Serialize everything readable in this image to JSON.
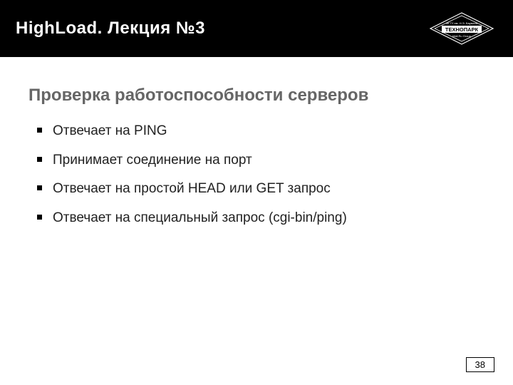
{
  "header": {
    "title": "HighLoad. Лекция №3",
    "logo_text_top": "МГТУ им. Н.Э. Баумана",
    "logo_text_main": "ТЕХНОПАРК",
    "logo_text_sub": "Mail.Ru Group"
  },
  "content": {
    "heading": "Проверка работоспособности серверов",
    "bullets": [
      "Отвечает на PING",
      "Принимает соединение на порт",
      "Отвечает на простой HEAD или GET запрос",
      "Отвечает на специальный запрос (cgi-bin/ping)"
    ]
  },
  "page_number": "38"
}
